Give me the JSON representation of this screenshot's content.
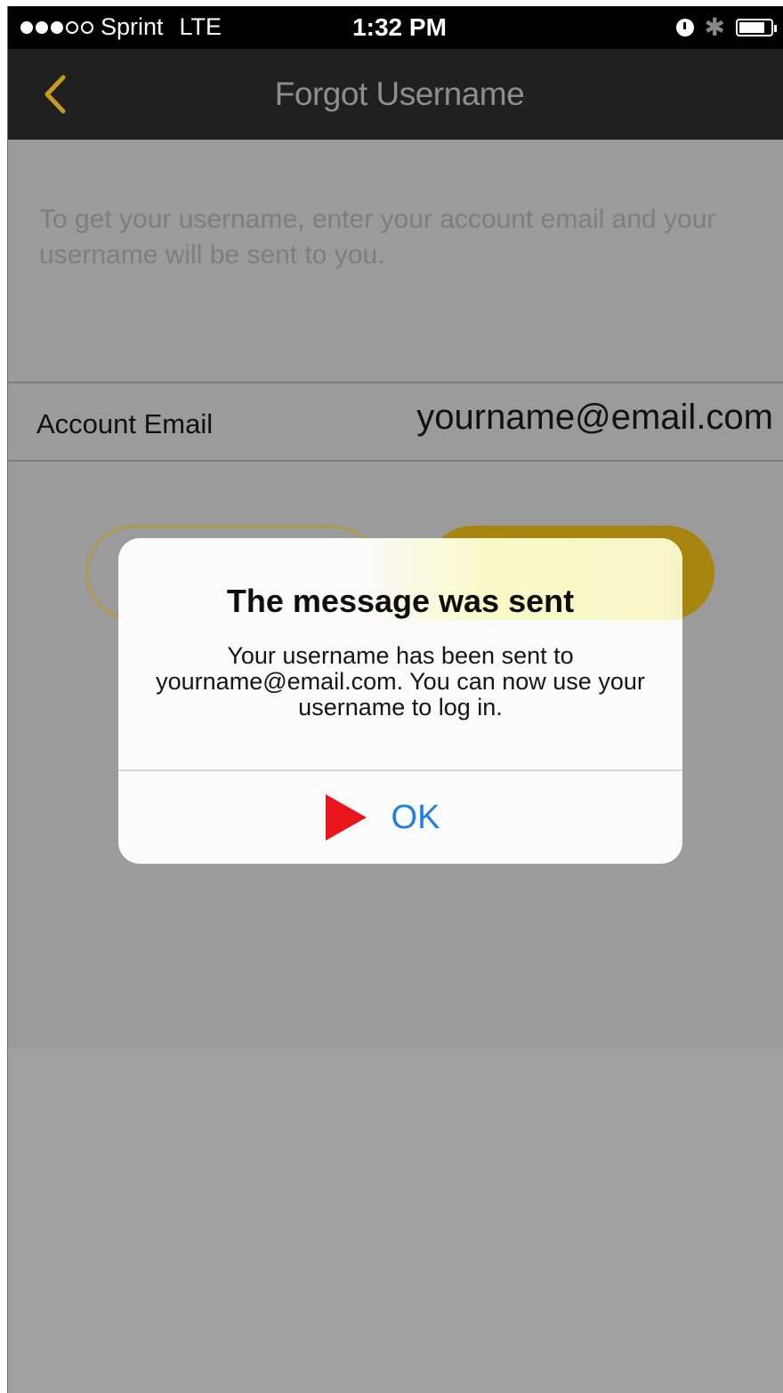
{
  "status_bar": {
    "carrier": "Sprint",
    "network": "LTE",
    "time": "1:32 PM",
    "signal_bars_filled": 3,
    "signal_bars_total": 5
  },
  "nav": {
    "title": "Forgot Username",
    "back_icon": "chevron-left-icon"
  },
  "form": {
    "instructions": "To get your username, enter your account email and your username will be sent to you.",
    "email_label": "Account Email",
    "email_value": "yourname@email.com"
  },
  "alert": {
    "title": "The message was sent",
    "message": "Your username has been sent to yourname@email.com. You can now use your username to log in.",
    "ok_label": "OK",
    "marker_icon": "red-play-arrow-icon"
  },
  "colors": {
    "accent_gold": "#a7850f",
    "link_blue": "#1e7fe5",
    "marker_red": "#e8151c"
  }
}
